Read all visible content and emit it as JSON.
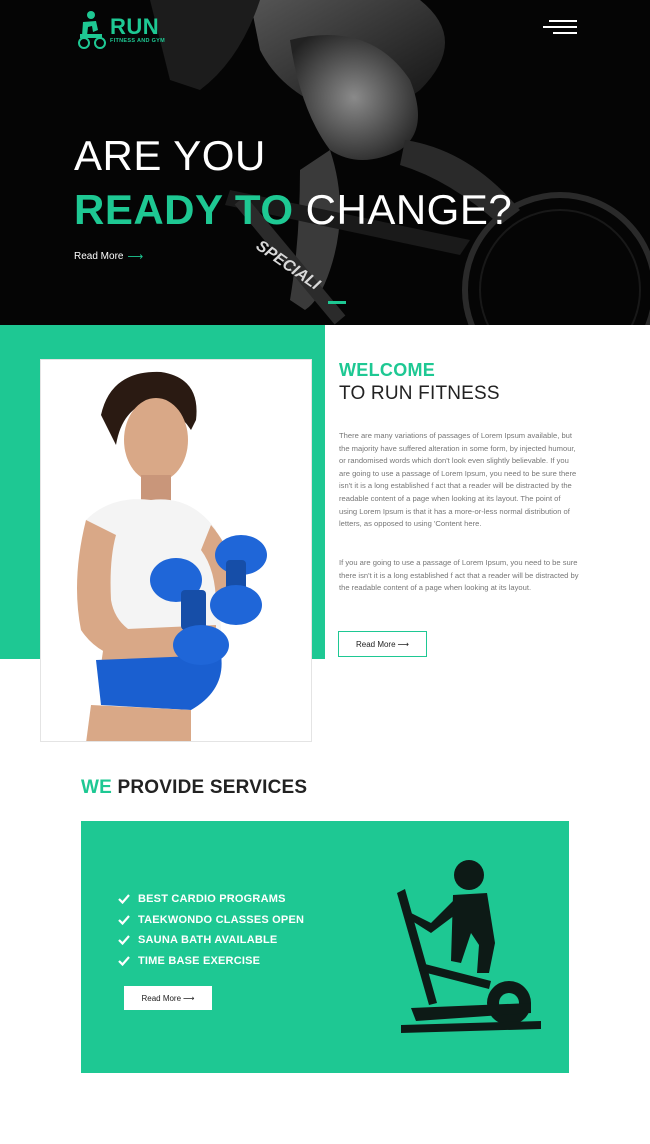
{
  "brand": {
    "name": "RUN",
    "tagline": "FITNESS AND GYM",
    "accent_color": "#1ec893"
  },
  "header": {
    "menu_icon": "hamburger-menu-icon"
  },
  "hero": {
    "line1": "ARE YOU",
    "line2_accent": "READY TO",
    "line2_rest": "CHANGE?",
    "link_label": "Read More",
    "link_icon": "arrow-right-icon"
  },
  "welcome": {
    "title": "WELCOME",
    "subtitle": "TO RUN FITNESS",
    "paragraph1": "There are many variations of passages of Lorem Ipsum available, but the majority have suffered alteration in some form, by injected humour, or randomised words which don't look even slightly believable. If you are going to use a passage of Lorem Ipsum, you need to be sure there isn't it is a long established f act that a reader will be distracted by the readable content of a page when looking at its layout. The point of using Lorem Ipsum is that it has a more-or-less normal distribution of letters, as opposed to using 'Content here.",
    "paragraph2": "If you are going to use a passage of Lorem Ipsum, you need to be sure there isn't it is a long established f act that a reader will be distracted by the readable content of a page when looking at its layout.",
    "button_label": "Read More"
  },
  "services": {
    "title_accent": "WE",
    "title_rest": "PROVIDE SERVICES",
    "items": [
      "BEST CARDIO PROGRAMS",
      "TAEKWONDO CLASSES OPEN",
      "SAUNA BATH AVAILABLE",
      "TIME BASE EXERCISE"
    ],
    "button_label": "Read More",
    "icon": "elliptical-trainer-icon"
  }
}
